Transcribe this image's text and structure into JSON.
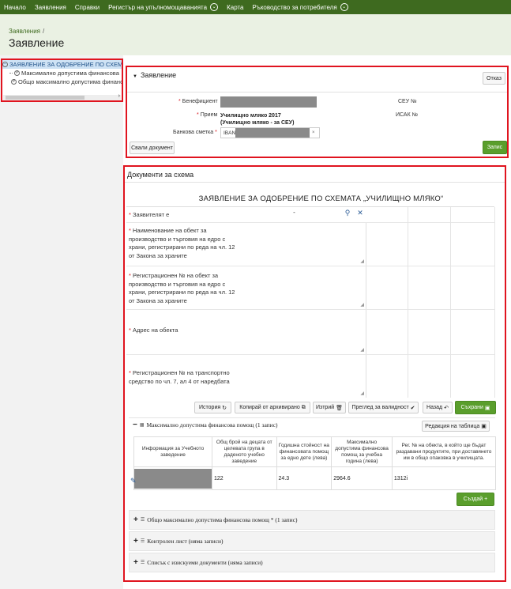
{
  "nav": {
    "items": [
      "Начало",
      "Заявления",
      "Справки",
      "Регистър на упълномощаванията",
      "Карта",
      "Ръководство за потребителя"
    ]
  },
  "breadcrumb": {
    "link": "Заявления",
    "sep": "/"
  },
  "page": {
    "title": "Заявление"
  },
  "tree": {
    "root": "ЗАЯВЛЕНИЕ ЗА ОДОБРЕНИЕ ПО СХЕМА",
    "child1": "Максимално допустима финансова",
    "child2": "Общо максимално допустима финанс"
  },
  "application": {
    "title": "Заявление",
    "cancel_btn": "Отказ",
    "beneficiary_label": "Бенефициент",
    "receipt_label": "Прием",
    "receipt_value": "Училищно мляко 2017 (Училищно мляко - за СЕУ)",
    "bank_label": "Банкова сметка",
    "iban_prefix": "IBAN",
    "seu_label": "СЕУ №",
    "isak_label": "ИСАК №",
    "download_btn": "Свали документ",
    "save_btn": "Запис"
  },
  "documents": {
    "title": "Документи за схема",
    "form_title": "ЗАЯВЛЕНИЕ ЗА ОДОБРЕНИЕ ПО СХЕМАТА „УЧИЛИЩНО МЛЯКО“",
    "applicant_label": "Заявителят е",
    "applicant_value": "-",
    "field1": "Наименование на обект за производство и търговия на едро с храни, регистрирани по реда на чл. 12 от Закона за храните",
    "field2": "Регистрационен № на обект за производство и търговия на едро с храни, регистрирани по реда на чл. 12 от Закона за храните",
    "field3": "Адрес на обекта",
    "field4": "Регистрационен № на транспортно средство по чл. 7, ал 4 от наредбата"
  },
  "toolbar": {
    "history": "История",
    "copy": "Копирай от архивирано",
    "delete": "Изтрий",
    "validate": "Преглед за валидност",
    "back": "Назад",
    "save": "Съхрани"
  },
  "section1": {
    "title": "Максимално допустима финансова помощ (1 запис)",
    "edit_table": "Редакция на таблица",
    "columns": [
      "Информация за Учебното заведение",
      "Общ брой на децата от целевата група в даденото учебно заведение",
      "Годишна стойност на финансовата помощ за едно дете (лева)",
      "Максимално допустима финансова помощ за учебна година (лева)",
      "Рег. № на обекта, в който ще бъдат раздавани продуктите, при доставянето им в общо опаковка в училищата."
    ],
    "row": [
      "",
      "122",
      "24.3",
      "2964.6",
      "1312i"
    ],
    "create_btn": "Създай"
  },
  "sections": {
    "s2": "Общо максимално допустима финансова помощ * (1 запис)",
    "s3": "Контролен лист (няма записи)",
    "s4": "Списък с изискуеми документи (няма записи)"
  },
  "colors": {
    "nav": "#3e6a1f",
    "header_bg": "#eaf1e3",
    "accent_green": "#5a9e2c",
    "highlight_red": "#e0141f"
  }
}
